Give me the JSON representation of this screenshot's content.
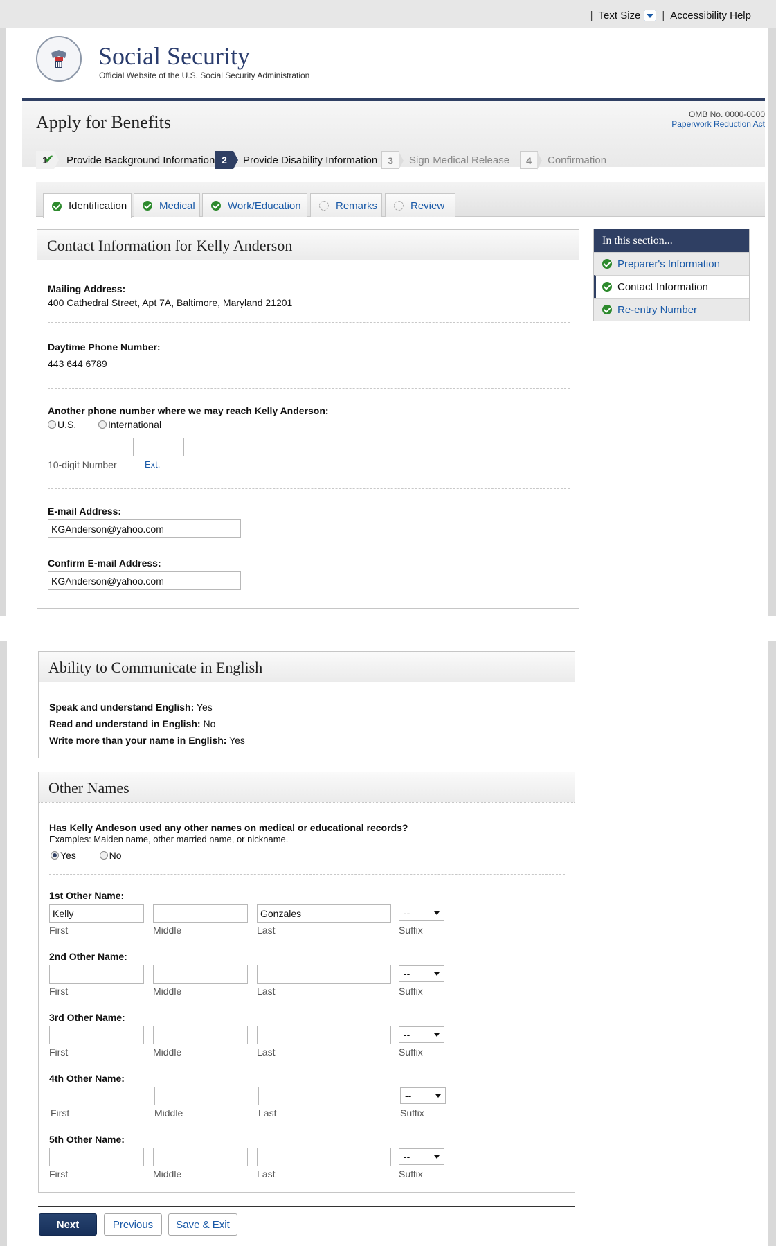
{
  "utility": {
    "text_size": "Text Size",
    "accessibility": "Accessibility Help",
    "sep": "|"
  },
  "brand": {
    "title": "Social Security",
    "subtitle": "Official Website of the U.S. Social Security Administration"
  },
  "page": {
    "title": "Apply for Benefits",
    "omb": "OMB No. 0000-0000",
    "paperwork": "Paperwork Reduction Act"
  },
  "steps": [
    {
      "num": "1",
      "label": "Provide Background Information",
      "state": "done"
    },
    {
      "num": "2",
      "label": "Provide Disability Information",
      "state": "active"
    },
    {
      "num": "3",
      "label": "Sign Medical Release",
      "state": "todo"
    },
    {
      "num": "4",
      "label": "Confirmation",
      "state": "todo"
    }
  ],
  "tabs": [
    {
      "label": "Identification",
      "status": "complete",
      "selected": true
    },
    {
      "label": "Medical",
      "status": "complete"
    },
    {
      "label": "Work/Education",
      "status": "complete"
    },
    {
      "label": "Remarks",
      "status": "pending"
    },
    {
      "label": "Review",
      "status": "pending"
    }
  ],
  "sidenav": {
    "heading": "In this section...",
    "items": [
      {
        "label": "Preparer's Information",
        "current": false
      },
      {
        "label": "Contact Information",
        "current": true
      },
      {
        "label": "Re-entry Number",
        "current": false
      }
    ]
  },
  "contact": {
    "heading": "Contact Information for Kelly Anderson",
    "mailing_label": "Mailing Address:",
    "mailing_value": "400 Cathedral Street, Apt 7A, Baltimore, Maryland 21201",
    "phone_label": "Daytime Phone Number:",
    "phone_value": "443 644 6789",
    "other_phone_label": "Another phone number where we may reach Kelly Anderson:",
    "radio_us": "U.S.",
    "radio_intl": "International",
    "ten_digit": "10-digit Number",
    "ext": "Ext.",
    "email_label": "E-mail Address:",
    "email_value": "KGAnderson@yahoo.com",
    "confirm_email_label": "Confirm E-mail Address:",
    "confirm_email_value": "KGAnderson@yahoo.com"
  },
  "english": {
    "heading": "Ability to Communicate in English",
    "speak_label": "Speak and understand English:",
    "speak_value": "Yes",
    "read_label": "Read and understand in English:",
    "read_value": "No",
    "write_label": "Write more than your name in English:",
    "write_value": "Yes"
  },
  "other_names": {
    "heading": "Other Names",
    "question": "Has Kelly Andeson used any other names on medical or educational records?",
    "examples": "Examples: Maiden name, other married name, or nickname.",
    "yes": "Yes",
    "no": "No",
    "selected": "Yes",
    "sub_first": "First",
    "sub_middle": "Middle",
    "sub_last": "Last",
    "sub_suffix": "Suffix",
    "suffix_default": "--",
    "names": [
      {
        "label": "1st Other Name:",
        "first": "Kelly",
        "middle": "",
        "last": "Gonzales"
      },
      {
        "label": "2nd Other Name:",
        "first": "",
        "middle": "",
        "last": ""
      },
      {
        "label": "3rd Other Name:",
        "first": "",
        "middle": "",
        "last": ""
      },
      {
        "label": "4th Other Name:",
        "first": "",
        "middle": "",
        "last": ""
      },
      {
        "label": "5th Other Name:",
        "first": "",
        "middle": "",
        "last": ""
      }
    ]
  },
  "buttons": {
    "next": "Next",
    "previous": "Previous",
    "save_exit": "Save & Exit"
  }
}
